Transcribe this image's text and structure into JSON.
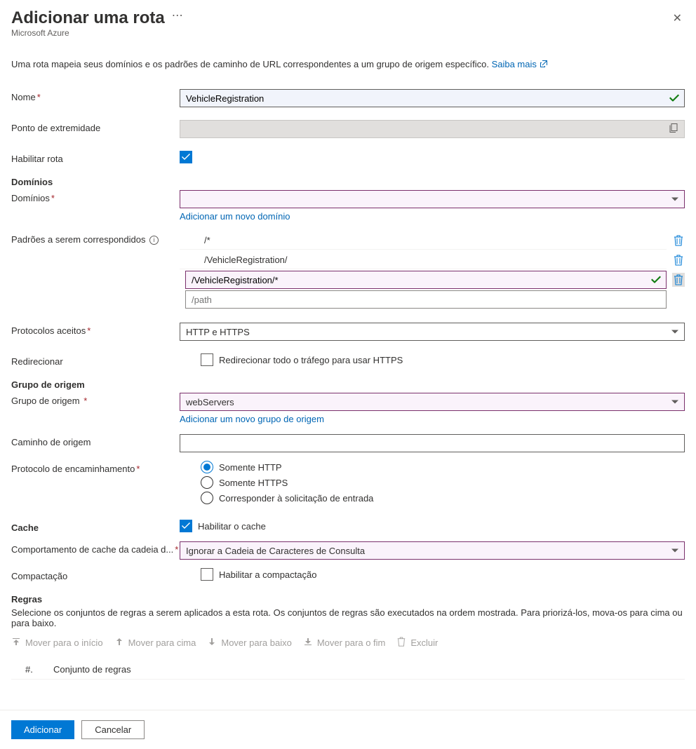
{
  "header": {
    "title": "Adicionar uma rota",
    "subtitle": "Microsoft Azure"
  },
  "intro": {
    "text": "Uma rota mapeia seus domínios e os padrões de caminho de URL correspondentes a um grupo de origem específico. ",
    "link": "Saiba mais"
  },
  "form": {
    "name_label": "Nome",
    "name_value": "VehicleRegistration",
    "endpoint_label": "Ponto de extremidade",
    "endpoint_value": "",
    "enable_route_label": "Habilitar rota",
    "enable_route_checked": true
  },
  "domains": {
    "heading": "Domínios",
    "label": "Domínios",
    "value": "",
    "add_link": "Adicionar um novo domínio"
  },
  "patterns": {
    "label": "Padrões a serem correspondidos",
    "items": [
      {
        "value": "/*"
      },
      {
        "value": "/VehicleRegistration/"
      },
      {
        "value": "/VehicleRegistration/*"
      }
    ],
    "new_placeholder": "/path"
  },
  "protocols": {
    "label": "Protocolos aceitos",
    "value": "HTTP e HTTPS"
  },
  "redirect": {
    "label": "Redirecionar",
    "checkbox_label": "Redirecionar todo o tráfego para usar HTTPS",
    "checked": false
  },
  "origin": {
    "heading": "Grupo de origem",
    "group_label": "Grupo de origem",
    "group_value": "webServers",
    "add_link": "Adicionar um novo grupo de origem",
    "path_label": "Caminho de origem",
    "path_value": "",
    "fwd_proto_label": "Protocolo de encaminhamento",
    "options": {
      "http": "Somente HTTP",
      "https": "Somente HTTPS",
      "match": "Corresponder à solicitação de entrada"
    }
  },
  "cache": {
    "heading": "Cache",
    "enable_label": "Habilitar o cache",
    "enable_checked": true,
    "behavior_label": "Comportamento de cache da cadeia d...",
    "behavior_value": "Ignorar a Cadeia de Caracteres de Consulta",
    "compression_label": "Compactação",
    "compression_checkbox_label": "Habilitar a compactação",
    "compression_checked": false
  },
  "rules": {
    "heading": "Regras",
    "desc": "Selecione os conjuntos de regras a serem aplicados a esta rota. Os conjuntos de regras são executados na ordem mostrada. Para priorizá-los, mova-os para cima ou para baixo.",
    "toolbar": {
      "top": "Mover para o início",
      "up": "Mover para cima",
      "down": "Mover para baixo",
      "bottom": "Mover para o fim",
      "delete": "Excluir"
    },
    "col_num": "#.",
    "col_set": "Conjunto de regras"
  },
  "footer": {
    "add": "Adicionar",
    "cancel": "Cancelar"
  }
}
